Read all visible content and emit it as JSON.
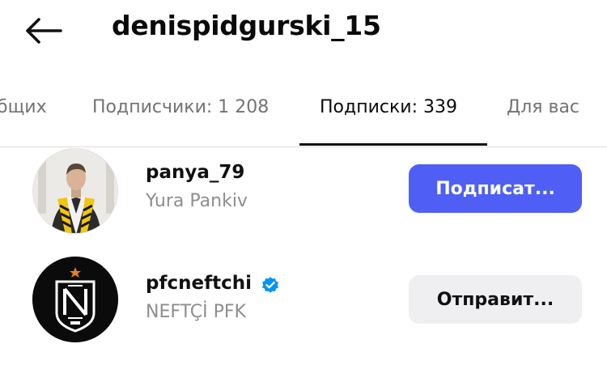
{
  "header": {
    "back_icon": "arrow-left-icon",
    "username": "denispidgurski_15"
  },
  "tabs": [
    {
      "label": "бщих",
      "active": false
    },
    {
      "label": "Подписчики: 1 208",
      "active": false
    },
    {
      "label": "Подписки: 339",
      "active": true
    },
    {
      "label": "Для вас",
      "active": false
    }
  ],
  "accounts": [
    {
      "username": "panya_79",
      "full_name": "Yura Pankiv",
      "verified": false,
      "avatar": "person-photo-avatar",
      "button_label": "Подписат...",
      "button_style": "primary"
    },
    {
      "username": "pfcneftchi",
      "full_name": "NEFTÇİ PFK",
      "verified": true,
      "verified_icon": "verified-badge-icon",
      "avatar": "neftchi-club-logo",
      "button_label": "Отправит...",
      "button_style": "secondary"
    }
  ],
  "colors": {
    "primary_button": "#4f5ff5",
    "secondary_button": "#efeff1",
    "verified_badge": "#0095f6",
    "muted_text": "#8e8e8e"
  }
}
